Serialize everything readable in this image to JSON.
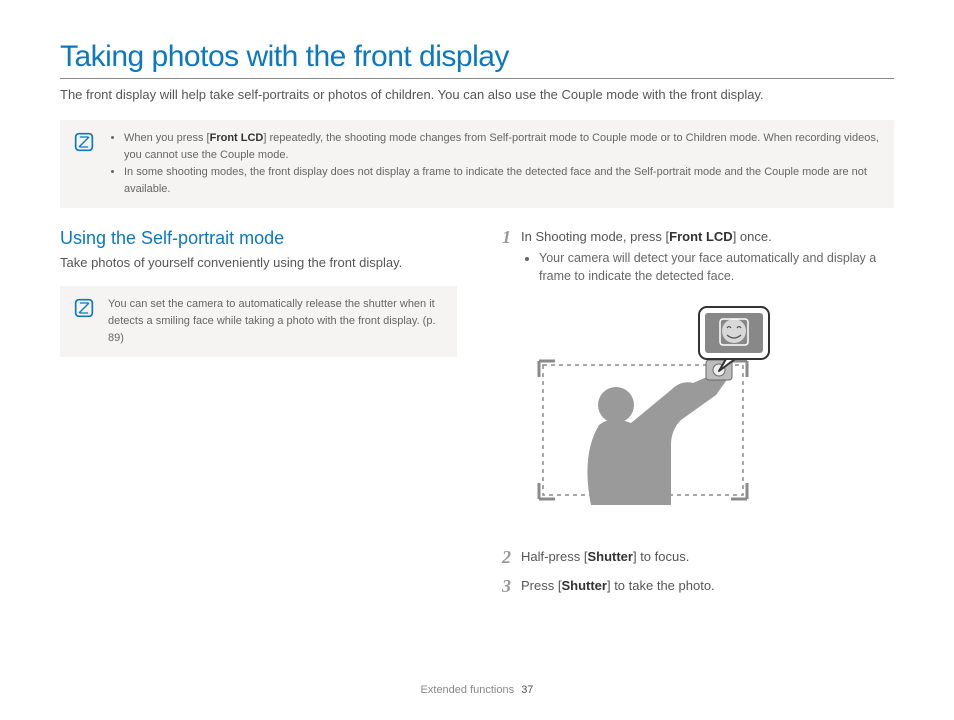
{
  "title": "Taking photos with the front display",
  "intro": "The front display will help take self-portraits or photos of children. You can also use the Couple mode with the front display.",
  "topnote": {
    "items": [
      {
        "pre": "When you press [",
        "bold": "Front LCD",
        "post": "] repeatedly, the shooting mode changes from Self-portrait mode to Couple mode or to Children mode. When recording videos, you cannot use the Couple mode."
      },
      {
        "pre": "In some shooting modes, the front display does not display a frame to indicate the detected face and the Self-portrait mode and the Couple mode are not available.",
        "bold": "",
        "post": ""
      }
    ]
  },
  "left": {
    "heading": "Using the Self-portrait mode",
    "sub": "Take photos of yourself conveniently using the front display.",
    "note": "You can set the camera to automatically release the shutter when it detects a smiling face while taking a photo with the front display. (p. 89)"
  },
  "right": {
    "steps": [
      {
        "num": "1",
        "pre": "In Shooting mode, press [",
        "bold": "Front LCD",
        "post": "] once.",
        "bullet": "Your camera will detect your face automatically and display a frame to indicate the detected face."
      },
      {
        "num": "2",
        "pre": "Half-press [",
        "bold": "Shutter",
        "post": "] to focus."
      },
      {
        "num": "3",
        "pre": "Press [",
        "bold": "Shutter",
        "post": "] to take the photo."
      }
    ]
  },
  "footer": {
    "section": "Extended functions",
    "page": "37"
  }
}
